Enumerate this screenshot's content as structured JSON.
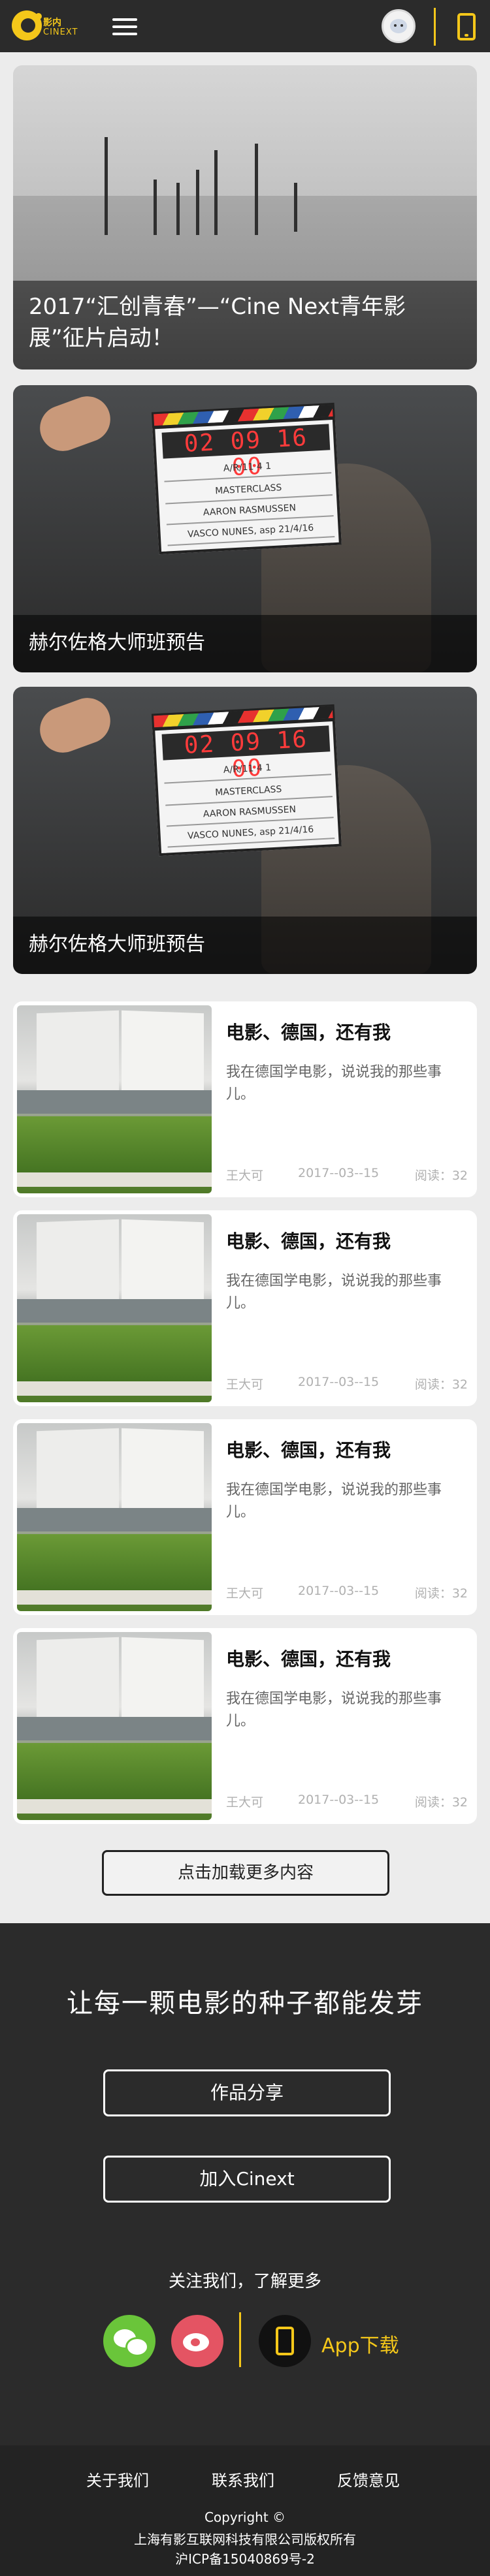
{
  "header": {
    "logo_cn": "影内",
    "logo_en": "CINEXT"
  },
  "heroes": [
    {
      "caption": "2017“汇创青春”—“Cine Next青年影展”征片启动！"
    },
    {
      "caption": "赫尔佐格大师班预告",
      "clapper_time": "02 09 16 00",
      "clapper_rows": [
        "A/R/11   4   1",
        "MASTERCLASS",
        "AARON RASMUSSEN",
        "VASCO NUNES, asp   21/4/16"
      ]
    },
    {
      "caption": "赫尔佐格大师班预告",
      "clapper_time": "02 09 16 00",
      "clapper_rows": [
        "A/R/11   4   1",
        "MASTERCLASS",
        "AARON RASMUSSEN",
        "VASCO NUNES, asp   21/4/16"
      ]
    }
  ],
  "articles": [
    {
      "title": "电影、德国，还有我",
      "desc": "我在德国学电影，说说我的那些事儿。",
      "author": "王大可",
      "date": "2017--03--15",
      "reads": "阅读：32"
    },
    {
      "title": "电影、德国，还有我",
      "desc": "我在德国学电影，说说我的那些事儿。",
      "author": "王大可",
      "date": "2017--03--15",
      "reads": "阅读：32"
    },
    {
      "title": "电影、德国，还有我",
      "desc": "我在德国学电影，说说我的那些事儿。",
      "author": "王大可",
      "date": "2017--03--15",
      "reads": "阅读：32"
    },
    {
      "title": "电影、德国，还有我",
      "desc": "我在德国学电影，说说我的那些事儿。",
      "author": "王大可",
      "date": "2017--03--15",
      "reads": "阅读：32"
    }
  ],
  "load_more": "点击加载更多内容",
  "footer": {
    "slogan": "让每一颗电影的种子都能发芽",
    "btn_share": "作品分享",
    "btn_join": "加入Cinext",
    "follow": "关注我们，了解更多",
    "app_download": "App下载"
  },
  "bottom": {
    "links": [
      "关于我们",
      "联系我们",
      "反馈意见"
    ],
    "copyright": "Copyright ©",
    "company": "上海有影互联网科技有限公司版权所有",
    "icp": "沪ICP备15040869号-2"
  },
  "colors": {
    "brand_yellow": "#f4c71a",
    "dark_bg": "#2b2b2b",
    "page_bg": "#ececec"
  },
  "icons": [
    "menu-icon",
    "avatar",
    "phone-icon",
    "wechat-icon",
    "weibo-icon",
    "app-phone-icon"
  ]
}
